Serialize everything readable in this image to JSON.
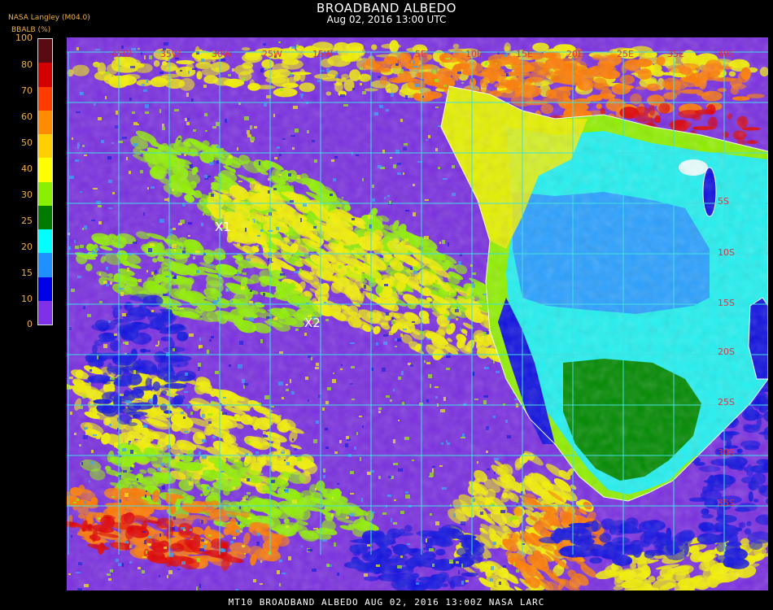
{
  "header": {
    "title": "BROADBAND ALBEDO",
    "subtitle": "Aug 02, 2016 13:00 UTC",
    "credit": "NASA Langley (M04.0)",
    "units": "BBALB (%)"
  },
  "scale": {
    "ticks": [
      "100",
      "80",
      "70",
      "60",
      "50",
      "40",
      "30",
      "25",
      "20",
      "15",
      "10",
      "0"
    ],
    "colors": [
      "#5a0a12",
      "#d20000",
      "#ff3c00",
      "#ff8c00",
      "#ffd000",
      "#ffff00",
      "#88f000",
      "#007a00",
      "#00ffff",
      "#1e90ff",
      "#0000e8",
      "#8030e6"
    ]
  },
  "map": {
    "markers": [
      {
        "label": "X1"
      },
      {
        "label": "X2"
      }
    ],
    "lat_labels": [
      "5S",
      "10S",
      "15S",
      "20S",
      "25S",
      "30S",
      "35S"
    ],
    "lon_labels": [
      "45W",
      "35W",
      "30W",
      "25W",
      "15W",
      "5E",
      "10E",
      "15E",
      "20E",
      "25E",
      "35E",
      "40E"
    ],
    "palette": {
      "ocean": "#7a2ee0",
      "land_low": "#2aa0ff",
      "land_cyan": "#22f0f0",
      "land_green": "#008a00",
      "cloud_yellow": "#f4f000",
      "cloud_green": "#90f000",
      "cloud_orange": "#ff7a00",
      "cloud_red": "#e00000",
      "low_blue": "#1010e0",
      "grid": "#40e0e0",
      "coast": "#ffffff"
    }
  },
  "footer": {
    "text": "MT10  BROADBAND ALBEDO   AUG 02, 2016 13:00Z   NASA LARC"
  }
}
